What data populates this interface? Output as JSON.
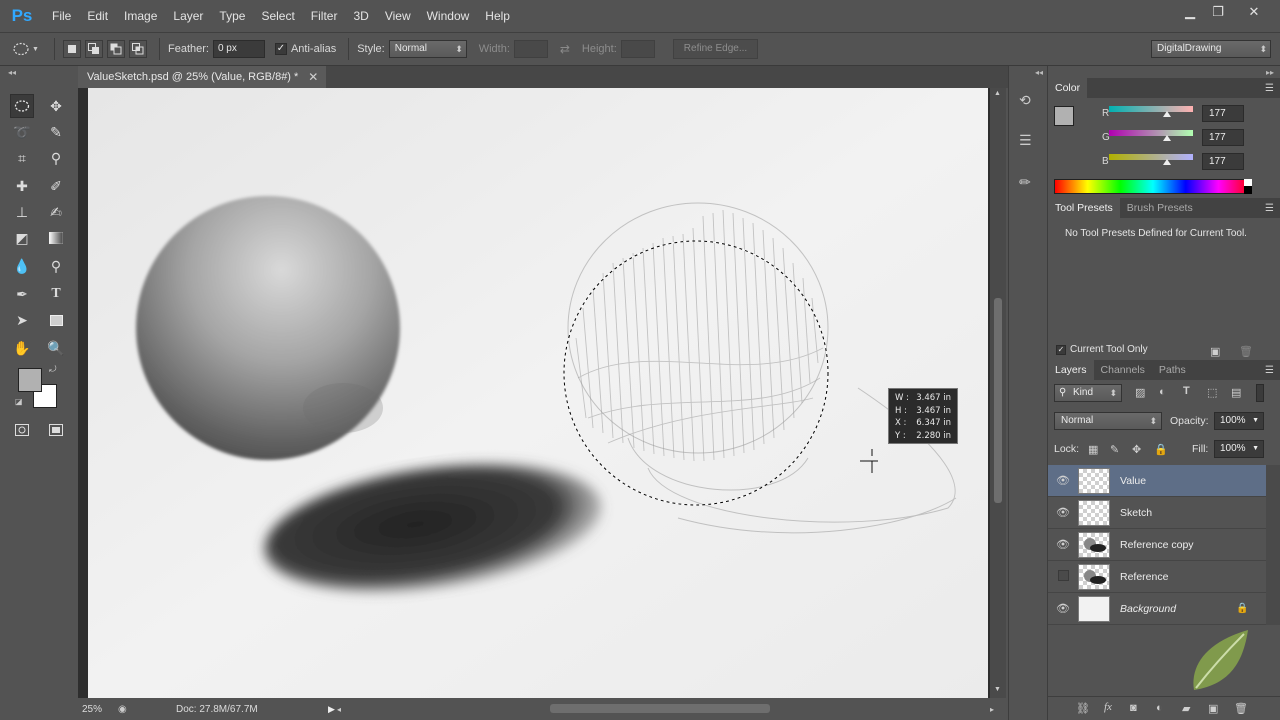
{
  "app": {
    "logo": "Ps"
  },
  "menu": [
    "File",
    "Edit",
    "Image",
    "Layer",
    "Type",
    "Select",
    "Filter",
    "3D",
    "View",
    "Window",
    "Help"
  ],
  "options": {
    "feather_label": "Feather:",
    "feather_value": "0 px",
    "antialias_label": "Anti-alias",
    "style_label": "Style:",
    "style_value": "Normal",
    "width_label": "Width:",
    "height_label": "Height:",
    "refine_edge": "Refine Edge...",
    "workspace": "DigitalDrawing"
  },
  "document": {
    "tab_title": "ValueSketch.psd @ 25% (Value, RGB/8#) *",
    "zoom": "25%",
    "doc_size": "Doc: 27.8M/67.7M"
  },
  "measure": {
    "w_label": "W :",
    "w_value": "3.467 in",
    "h_label": "H :",
    "h_value": "3.467 in",
    "x_label": "X :",
    "x_value": "6.347 in",
    "y_label": "Y :",
    "y_value": "2.280 in"
  },
  "color_panel": {
    "tab": "Color",
    "r_label": "R",
    "r_value": "177",
    "g_label": "G",
    "g_value": "177",
    "b_label": "B",
    "b_value": "177",
    "fg_color": "#b1b1b1",
    "r_level": 0.694,
    "g_level": 0.694,
    "b_level": 0.694
  },
  "presets_panel": {
    "tabs": [
      "Tool Presets",
      "Brush Presets"
    ],
    "message": "No Tool Presets Defined for Current Tool.",
    "current_only": "Current Tool Only"
  },
  "layers_panel": {
    "tabs": [
      "Layers",
      "Channels",
      "Paths"
    ],
    "kind": "Kind",
    "blend_mode": "Normal",
    "opacity_label": "Opacity:",
    "opacity_value": "100%",
    "lock_label": "Lock:",
    "fill_label": "Fill:",
    "fill_value": "100%",
    "layers": [
      {
        "name": "Value",
        "visible": true,
        "selected": true,
        "italic": false
      },
      {
        "name": "Sketch",
        "visible": true,
        "selected": false,
        "italic": false
      },
      {
        "name": "Reference copy",
        "visible": true,
        "selected": false,
        "italic": false
      },
      {
        "name": "Reference",
        "visible": false,
        "selected": false,
        "italic": false
      },
      {
        "name": "Background",
        "visible": true,
        "selected": false,
        "italic": true
      }
    ]
  }
}
